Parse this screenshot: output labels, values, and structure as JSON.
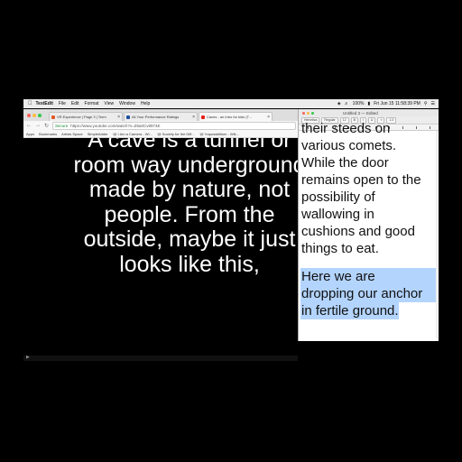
{
  "menubar": {
    "app_name": "TextEdit",
    "items": [
      "File",
      "Edit",
      "Format",
      "View",
      "Window",
      "Help"
    ],
    "battery": "100%",
    "clock": "Fri Jun 15  11:58:39 PM"
  },
  "browser": {
    "tabs": [
      {
        "label": "VR Experience | Page 3 | Term",
        "fav_color": "#e0592a"
      },
      {
        "label": "All Your Performance Ratings",
        "fav_color": "#1f4f9e"
      },
      {
        "label": "Caves - an intro for kids (T...",
        "fav_color": "#e62117"
      }
    ],
    "url_secure": "Secure",
    "url": "https://www.youtube.com/watch?v=Z6a0Cv8974E",
    "bookmarks": [
      "Apps",
      "Bookmarks",
      "Artists Space",
      "SimpleAdder",
      "'@ I Am a Camera - Wi...",
      "'@ Society for the Diff...",
      "'@ 'Impossibilism - Wik..."
    ]
  },
  "video": {
    "caption_lines": [
      "A cave is a tunnel or",
      "room way underground",
      "made by nature, not",
      "people.  From the",
      "outside, maybe it just",
      "looks like this,"
    ]
  },
  "textedit": {
    "title": "Untitled 3 — Edited",
    "format_controls": [
      "Helvetica",
      "Regular",
      "12",
      "1.0"
    ],
    "doc_lines": [
      "their steeds on",
      "various comets.",
      "While the door",
      "remains open to the",
      "possibility of",
      "wallowing in",
      "cushions and good",
      "things to eat."
    ],
    "selected_lines": [
      "Here we are",
      "dropping our anchor",
      "in fertile ground."
    ]
  },
  "colors": {
    "selection": "#b3d4fd",
    "background": "#000000"
  }
}
